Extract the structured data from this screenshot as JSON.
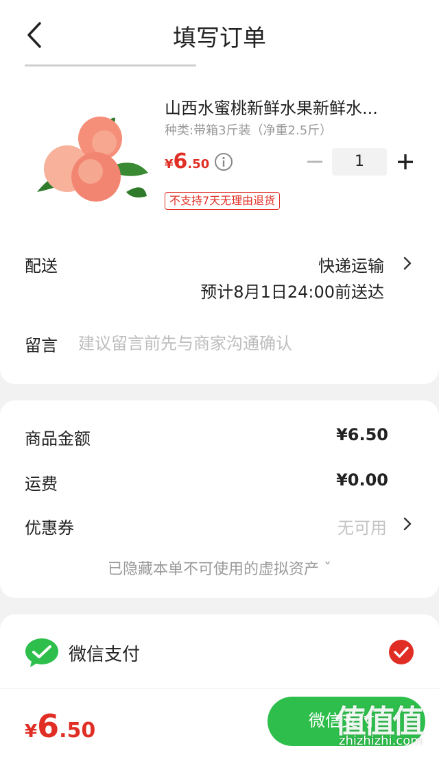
{
  "header": {
    "title": "填写订单"
  },
  "product": {
    "title": "山西水蜜桃新鲜水果新鲜水...",
    "spec": "种类:带箱3斤装（净重2.5斤）",
    "price_symbol": "¥",
    "price_int": "6",
    "price_dec": ".50",
    "quantity": "1",
    "return_policy": "不支持7天无理由退货"
  },
  "delivery": {
    "label": "配送",
    "method": "快递运输",
    "eta": "预计8月1日24:00前送达"
  },
  "message": {
    "label": "留言",
    "placeholder": "建议留言前先与商家沟通确认"
  },
  "summary": {
    "goods_label": "商品金额",
    "goods_value": "¥6.50",
    "shipping_label": "运费",
    "shipping_value": "¥0.00",
    "coupon_label": "优惠券",
    "coupon_value": "无可用",
    "hidden_assets": "已隐藏本单不可使用的虚拟资产 ˇ"
  },
  "payment": {
    "method_label": "微信支付",
    "total_symbol": "¥",
    "total_int": "6",
    "total_dec": ".50",
    "button_label": "微信支付"
  },
  "watermark": {
    "logo": "值值值",
    "site": "zhizhizhi.com"
  },
  "colors": {
    "accent": "#e02e24",
    "pay_green": "#2dbe4b",
    "wechat_green": "#2dbe4b"
  }
}
